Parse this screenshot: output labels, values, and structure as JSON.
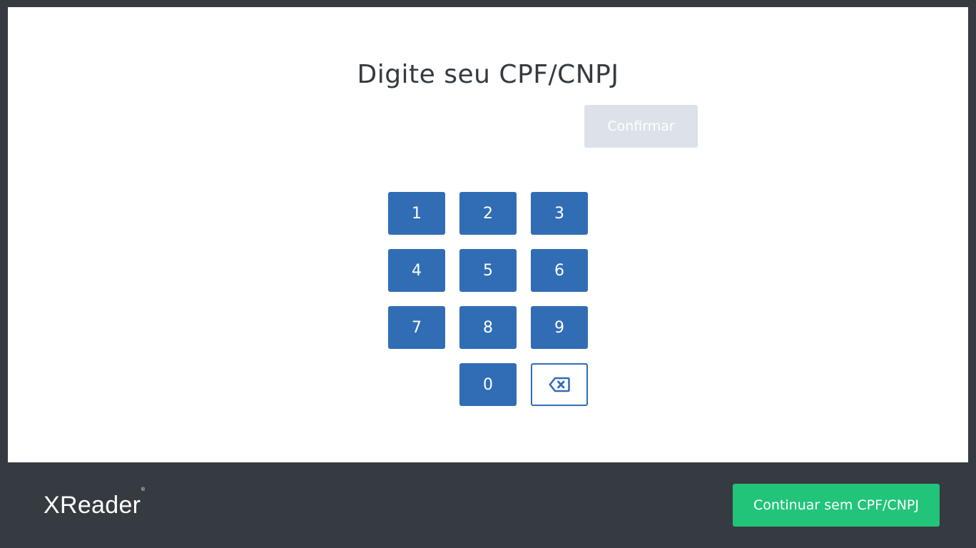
{
  "header": {
    "title": "Digite seu CPF/CNPJ"
  },
  "cpf_input": {
    "value": "",
    "placeholder": ""
  },
  "confirm_button": {
    "label": "Confirmar",
    "state": "disabled"
  },
  "keypad": {
    "keys": [
      "1",
      "2",
      "3",
      "4",
      "5",
      "6",
      "7",
      "8",
      "9",
      "0"
    ],
    "backspace_icon": "backspace-icon"
  },
  "footer": {
    "logo_text": "XReader",
    "logo_mark": "®",
    "skip_button_label": "Continuar sem CPF/CNPJ"
  },
  "colors": {
    "background": "#363a41",
    "card": "#ffffff",
    "keypad_primary": "#306db4",
    "confirm_disabled": "#dde2ea",
    "skip_button": "#22c47a",
    "title_text": "#343a40"
  }
}
